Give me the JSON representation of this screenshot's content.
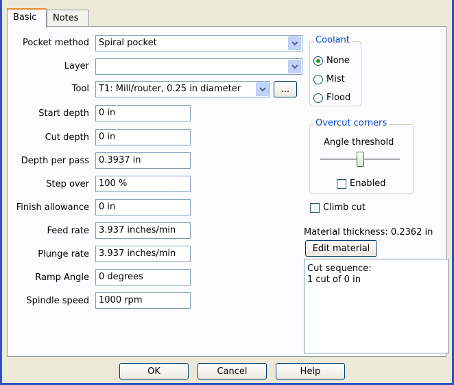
{
  "tabs": [
    "Basic",
    "Notes"
  ],
  "fields": {
    "pocket_method": {
      "label": "Pocket method",
      "value": "Spiral pocket"
    },
    "layer": {
      "label": "Layer",
      "value": ""
    },
    "tool": {
      "label": "Tool",
      "value": "T1: Mill/router, 0.25 in diameter",
      "browse": "..."
    },
    "start_depth": {
      "label": "Start depth",
      "value": "0 in"
    },
    "cut_depth": {
      "label": "Cut depth",
      "value": "0 in"
    },
    "depth_per_pass": {
      "label": "Depth per pass",
      "value": "0.3937 in"
    },
    "step_over": {
      "label": "Step over",
      "value": "100 %"
    },
    "finish_allowance": {
      "label": "Finish allowance",
      "value": "0 in"
    },
    "feed_rate": {
      "label": "Feed rate",
      "value": "3.937 inches/min"
    },
    "plunge_rate": {
      "label": "Plunge rate",
      "value": "3.937 inches/min"
    },
    "ramp_angle": {
      "label": "Ramp Angle",
      "value": "0 degrees"
    },
    "spindle_speed": {
      "label": "Spindle speed",
      "value": "1000 rpm"
    }
  },
  "coolant": {
    "title": "Coolant",
    "options": [
      "None",
      "Mist",
      "Flood"
    ],
    "selected": "None"
  },
  "overcut": {
    "title": "Overcut corners",
    "threshold_label": "Angle threshold",
    "enabled_label": "Enabled",
    "enabled": false,
    "slider_level": 0.5
  },
  "climb_cut": {
    "label": "Climb cut",
    "checked": false
  },
  "material": {
    "thickness_text": "Material thickness: 0.2362 in",
    "edit_button": "Edit material"
  },
  "cut_sequence": {
    "line1": "Cut sequence:",
    "line2": "1 cut of 0 in"
  },
  "buttons": {
    "ok": "OK",
    "cancel": "Cancel",
    "help": "Help"
  }
}
